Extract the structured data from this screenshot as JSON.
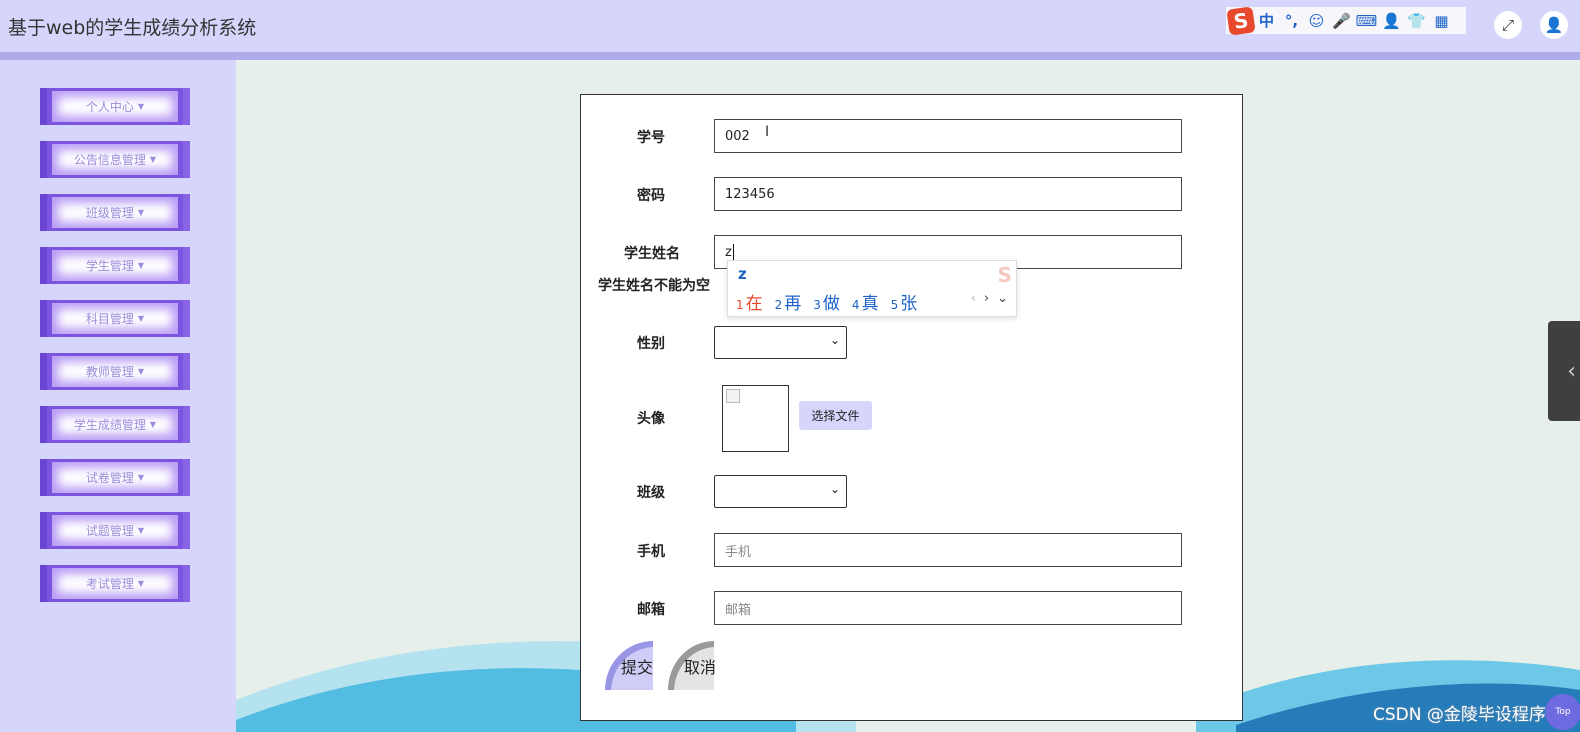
{
  "header": {
    "title": "基于web的学生成绩分析系统",
    "ime_toolbar": {
      "logo": "S",
      "items": [
        "中",
        "°,",
        "☺",
        "🎤",
        "⌨",
        "👤",
        "👕",
        "▦"
      ]
    },
    "fullscreen_icon": "⤢",
    "user_icon": "👤"
  },
  "sidebar": {
    "items": [
      {
        "label": "个人中心"
      },
      {
        "label": "公告信息管理"
      },
      {
        "label": "班级管理"
      },
      {
        "label": "学生管理"
      },
      {
        "label": "科目管理"
      },
      {
        "label": "教师管理"
      },
      {
        "label": "学生成绩管理"
      },
      {
        "label": "试卷管理"
      },
      {
        "label": "试题管理"
      },
      {
        "label": "考试管理"
      }
    ],
    "caret": "▼"
  },
  "form": {
    "student_no": {
      "label": "学号",
      "value": "002"
    },
    "password": {
      "label": "密码",
      "value": "123456"
    },
    "student_name": {
      "label": "学生姓名",
      "value": "z",
      "error": "学生姓名不能为空"
    },
    "gender": {
      "label": "性别",
      "selected": ""
    },
    "avatar": {
      "label": "头像",
      "file_button": "选择文件"
    },
    "class": {
      "label": "班级",
      "selected": ""
    },
    "phone": {
      "label": "手机",
      "placeholder": "手机"
    },
    "email": {
      "label": "邮箱",
      "placeholder": "邮箱"
    },
    "submit": "提交",
    "cancel": "取消"
  },
  "ime_popup": {
    "composition": "z",
    "candidates": [
      {
        "num": "1",
        "text": "在"
      },
      {
        "num": "2",
        "text": "再"
      },
      {
        "num": "3",
        "text": "做"
      },
      {
        "num": "4",
        "text": "真"
      },
      {
        "num": "5",
        "text": "张"
      }
    ],
    "prev": "‹",
    "next": "›",
    "expand": "⌄"
  },
  "side_tab_icon": "‹",
  "watermark": "CSDN @金陵毕设程序",
  "top_button": "Top",
  "colors": {
    "header_bg": "#d6d6fc",
    "menu_accent": "#7b55e0",
    "page_bg": "#e6efea",
    "ime_blue": "#1d63c8",
    "ime_red": "#e8482c"
  }
}
